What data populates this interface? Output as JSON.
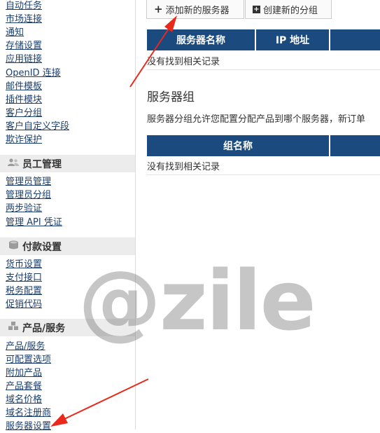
{
  "sidebar": {
    "top_links": [
      "自动任务",
      "市场连接",
      "通知",
      "存储设置",
      "应用链接",
      "OpenID 连接",
      "邮件模板",
      "插件模块",
      "客户分组",
      "客户自定义字段",
      "欺诈保护"
    ],
    "staff_header": "员工管理",
    "staff_links": [
      "管理员管理",
      "管理员分组",
      "两步验证",
      "管理 API 凭证"
    ],
    "payment_header": "付款设置",
    "payment_links": [
      "货币设置",
      "支付接口",
      "税务配置",
      "促销代码"
    ],
    "product_header": "产品/服务",
    "product_links": [
      "产品/服务",
      "可配置选项",
      "附加产品",
      "产品套餐",
      "域名价格",
      "域名注册商",
      "服务器设置"
    ]
  },
  "toolbar": {
    "add_server": "添加新的服务器",
    "create_group": "创建新的分组"
  },
  "servers_table": {
    "headers": [
      "服务器名称",
      "IP 地址"
    ],
    "empty": "没有找到相关记录"
  },
  "groups_section": {
    "title": "服务器组",
    "description": "服务器分组允许您配置分配产品到哪个服务器，新订单",
    "headers": [
      "组名称"
    ],
    "empty": "没有找到相关记录"
  },
  "watermark": "@zile",
  "icons": [
    "users-icon",
    "credit-card-icon",
    "cubes-icon",
    "plus-icon",
    "plus-square-icon"
  ],
  "colors": {
    "table_header": "#1a4a7e",
    "link": "#1c3f6e",
    "arrow": "#e8291c"
  }
}
